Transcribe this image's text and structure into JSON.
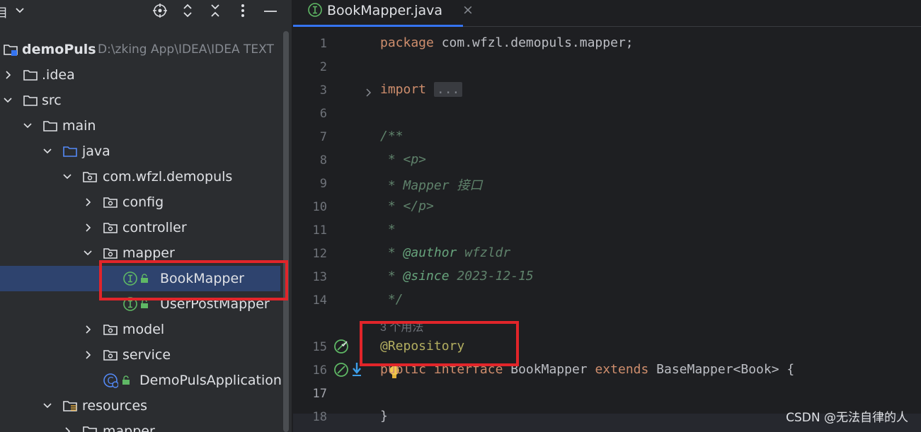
{
  "project_panel": {
    "title_fragment": "目",
    "toolbar": [
      "locate-icon",
      "expand-collapse-icon",
      "collapse-all-icon",
      "more-icon",
      "minimize-icon"
    ],
    "project_name": "demoPuls",
    "project_path": "D:\\zking App\\IDEA\\IDEA TEXT",
    "items": [
      {
        "label": ".idea"
      },
      {
        "label": "src"
      },
      {
        "label": "main"
      },
      {
        "label": "java"
      },
      {
        "label": "com.wfzl.demopuls"
      },
      {
        "label": "config"
      },
      {
        "label": "controller"
      },
      {
        "label": "mapper"
      },
      {
        "label": "BookMapper"
      },
      {
        "label": "UserPostMapper"
      },
      {
        "label": "model"
      },
      {
        "label": "service"
      },
      {
        "label": "DemoPulsApplication"
      },
      {
        "label": "resources"
      },
      {
        "label": "mapper"
      }
    ]
  },
  "editor": {
    "tab": {
      "label": "BookMapper.java",
      "close": "×"
    },
    "lines": {
      "l1": {
        "num": "1",
        "kw": "package",
        "text": " com.wfzl.demopuls.mapper;"
      },
      "l2": {
        "num": "2"
      },
      "l3": {
        "num": "3",
        "kw": "import",
        "folded": "..."
      },
      "l6": {
        "num": "6"
      },
      "l7": {
        "num": "7",
        "text": "/**"
      },
      "l8": {
        "num": "8",
        "text": " * <p>"
      },
      "l9": {
        "num": "9",
        "text": " * Mapper 接口"
      },
      "l10": {
        "num": "10",
        "text": " * </p>"
      },
      "l11": {
        "num": "11",
        "text": " *"
      },
      "l12": {
        "num": "12",
        "prefix": " * ",
        "tag": "@author",
        "text": " wfzldr"
      },
      "l13": {
        "num": "13",
        "prefix": " * ",
        "tag": "@since",
        "text": " 2023-12-15"
      },
      "l14": {
        "num": "14",
        "text": " */"
      },
      "usages": "3 个用法",
      "l15": {
        "num": "15",
        "annotation": "@Repository"
      },
      "l16": {
        "num": "16",
        "kw1": "public",
        "kw2": "interface",
        "name": " BookMapper ",
        "kw3": "extends",
        "rest": " BaseMapper<Book> {"
      },
      "l17": {
        "num": "17"
      },
      "l18": {
        "num": "18",
        "text": "}"
      }
    }
  },
  "colors": {
    "highlight": "#e1252a",
    "selection": "#2e436e",
    "accent": "#3574f0"
  },
  "watermark": "CSDN @无法自律的人"
}
